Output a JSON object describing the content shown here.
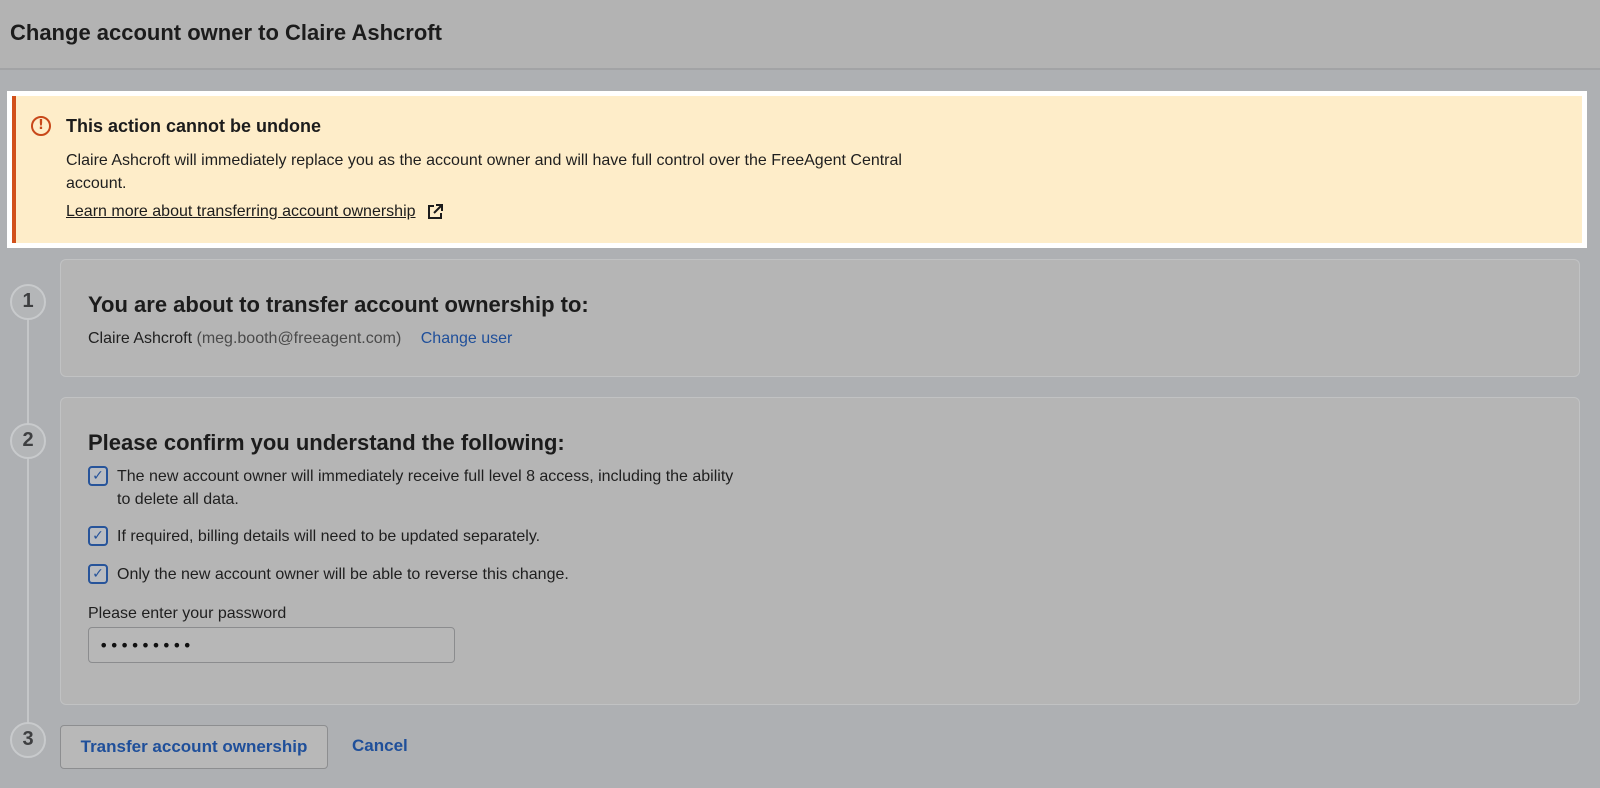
{
  "header": {
    "title": "Change account owner to Claire Ashcroft"
  },
  "alert": {
    "title": "This action cannot be undone",
    "body": "Claire Ashcroft will immediately replace you as the account owner and will have full control over the FreeAgent Central account.",
    "link_label": "Learn more about transferring account ownership",
    "icon": "alert-circle-icon",
    "accent_color": "#d2501a"
  },
  "steps": {
    "step1": {
      "number": "1",
      "heading": "You are about to transfer account ownership to:",
      "user_name": "Claire Ashcroft",
      "user_email": "(meg.booth@freeagent.com)",
      "change_user_label": "Change user"
    },
    "step2": {
      "number": "2",
      "heading": "Please confirm you understand the following:",
      "checks": [
        {
          "label": "The new account owner will immediately receive full level 8 access, including the ability to delete all data.",
          "checked": true
        },
        {
          "label": "If required, billing details will need to be updated separately.",
          "checked": true
        },
        {
          "label": "Only the new account owner will be able to reverse this change.",
          "checked": true
        }
      ],
      "password_label": "Please enter your password",
      "password_value": "•••••••••"
    },
    "step3": {
      "number": "3",
      "transfer_label": "Transfer account ownership",
      "cancel_label": "Cancel"
    }
  },
  "colors": {
    "link": "#1f4f9a",
    "checkbox": "#27549a",
    "alert_bg": "#feedc9"
  }
}
